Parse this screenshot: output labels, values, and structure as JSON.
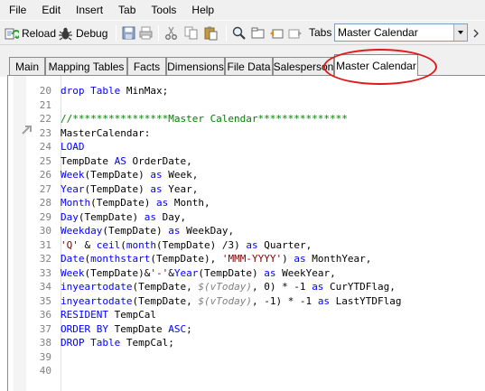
{
  "menu": [
    "File",
    "Edit",
    "Insert",
    "Tab",
    "Tools",
    "Help"
  ],
  "toolbar": {
    "reload_label": "Reload",
    "debug_label": "Debug",
    "tabs_label": "Tabs",
    "tabs_combo_value": "Master Calendar"
  },
  "tabs": [
    "Main",
    "Mapping Tables",
    "Facts",
    "Dimensions",
    "File Data",
    "Salesperson",
    "Master Calendar"
  ],
  "active_tab": "Master Calendar",
  "colors": {
    "keyword": "#0000ff",
    "string": "#800000",
    "comment": "#008000",
    "variable": "#808080",
    "highlight": "#e01818"
  },
  "editor": {
    "lines": [
      {
        "n": "20",
        "parts": [
          [
            "kw",
            "drop"
          ],
          [
            "plain",
            " "
          ],
          [
            "kw",
            "Table"
          ],
          [
            "plain",
            " MinMax;"
          ]
        ]
      },
      {
        "n": "21",
        "parts": []
      },
      {
        "n": "22",
        "parts": [
          [
            "cm",
            "//****************Master Calendar***************"
          ]
        ]
      },
      {
        "n": "23",
        "parts": [
          [
            "plain",
            "MasterCalendar:"
          ]
        ]
      },
      {
        "n": "24",
        "parts": [
          [
            "kw",
            "LOAD"
          ]
        ]
      },
      {
        "n": "25",
        "parts": [
          [
            "plain",
            "TempDate "
          ],
          [
            "kw",
            "AS"
          ],
          [
            "plain",
            " OrderDate,"
          ]
        ]
      },
      {
        "n": "26",
        "parts": [
          [
            "fn",
            "Week"
          ],
          [
            "plain",
            "(TempDate) "
          ],
          [
            "kw",
            "as"
          ],
          [
            "plain",
            " Week,"
          ]
        ]
      },
      {
        "n": "27",
        "parts": [
          [
            "fn",
            "Year"
          ],
          [
            "plain",
            "(TempDate) "
          ],
          [
            "kw",
            "as"
          ],
          [
            "plain",
            " Year,"
          ]
        ]
      },
      {
        "n": "28",
        "parts": [
          [
            "fn",
            "Month"
          ],
          [
            "plain",
            "(TempDate) "
          ],
          [
            "kw",
            "as"
          ],
          [
            "plain",
            " Month,"
          ]
        ]
      },
      {
        "n": "29",
        "parts": [
          [
            "fn",
            "Day"
          ],
          [
            "plain",
            "(TempDate) "
          ],
          [
            "kw",
            "as"
          ],
          [
            "plain",
            " Day,"
          ]
        ]
      },
      {
        "n": "30",
        "parts": [
          [
            "fn",
            "Weekday"
          ],
          [
            "plain",
            "(TempDate) "
          ],
          [
            "kw",
            "as"
          ],
          [
            "plain",
            " WeekDay,"
          ]
        ]
      },
      {
        "n": "31",
        "parts": [
          [
            "str",
            "'Q'"
          ],
          [
            "plain",
            " & "
          ],
          [
            "fn",
            "ceil"
          ],
          [
            "plain",
            "("
          ],
          [
            "fn",
            "month"
          ],
          [
            "plain",
            "(TempDate) /3) "
          ],
          [
            "kw",
            "as"
          ],
          [
            "plain",
            " Quarter,"
          ]
        ]
      },
      {
        "n": "32",
        "parts": [
          [
            "fn",
            "Date"
          ],
          [
            "plain",
            "("
          ],
          [
            "fn",
            "monthstart"
          ],
          [
            "plain",
            "(TempDate), "
          ],
          [
            "str",
            "'MMM-YYYY'"
          ],
          [
            "plain",
            ") "
          ],
          [
            "kw",
            "as"
          ],
          [
            "plain",
            " MonthYear,"
          ]
        ]
      },
      {
        "n": "33",
        "parts": [
          [
            "fn",
            "Week"
          ],
          [
            "plain",
            "(TempDate)&"
          ],
          [
            "str",
            "'-'"
          ],
          [
            "plain",
            "&"
          ],
          [
            "fn",
            "Year"
          ],
          [
            "plain",
            "(TempDate) "
          ],
          [
            "kw",
            "as"
          ],
          [
            "plain",
            " WeekYear,"
          ]
        ]
      },
      {
        "n": "34",
        "parts": [
          [
            "fn",
            "inyeartodate"
          ],
          [
            "plain",
            "(TempDate, "
          ],
          [
            "var",
            "$(vToday)"
          ],
          [
            "plain",
            ", 0) * -1 "
          ],
          [
            "kw",
            "as"
          ],
          [
            "plain",
            " CurYTDFlag,"
          ]
        ]
      },
      {
        "n": "35",
        "parts": [
          [
            "fn",
            "inyeartodate"
          ],
          [
            "plain",
            "(TempDate, "
          ],
          [
            "var",
            "$(vToday)"
          ],
          [
            "plain",
            ", -1) * -1 "
          ],
          [
            "kw",
            "as"
          ],
          [
            "plain",
            " LastYTDFlag"
          ]
        ]
      },
      {
        "n": "36",
        "parts": [
          [
            "kw",
            "RESIDENT"
          ],
          [
            "plain",
            " TempCal"
          ]
        ]
      },
      {
        "n": "37",
        "parts": [
          [
            "kw",
            "ORDER BY"
          ],
          [
            "plain",
            " TempDate "
          ],
          [
            "kw",
            "ASC"
          ],
          [
            "plain",
            ";"
          ]
        ]
      },
      {
        "n": "38",
        "parts": [
          [
            "kw",
            "DROP"
          ],
          [
            "plain",
            " "
          ],
          [
            "kw",
            "Table"
          ],
          [
            "plain",
            " TempCal;"
          ]
        ]
      },
      {
        "n": "39",
        "parts": []
      },
      {
        "n": "40",
        "parts": []
      }
    ]
  }
}
